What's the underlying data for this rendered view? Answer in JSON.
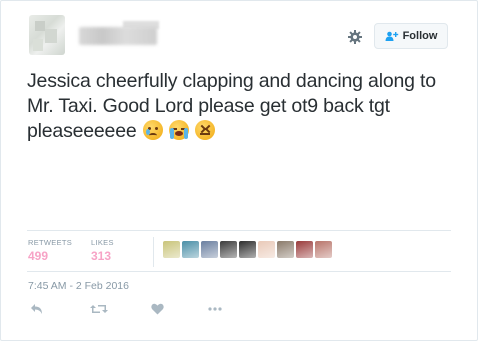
{
  "tweet": {
    "text": "Jessica cheerfully clapping and dancing along to Mr. Taxi. Good Lord please get ot9 back tgt pleaseeeeee",
    "emojis": [
      "crying-face",
      "loudly-crying-face",
      "confounded-face"
    ],
    "follow_label": "Follow",
    "timestamp": "7:45 AM - 2 Feb 2016"
  },
  "stats": {
    "retweets_label": "RETWEETS",
    "retweets_value": "499",
    "likes_label": "LIKES",
    "likes_value": "313"
  },
  "likers": [
    "#c9c47a",
    "#4a8fa7",
    "#6a7fa0",
    "#3b3b3b",
    "#2d2d2d",
    "#e9c9b8",
    "#8a7a6a",
    "#9a3b3b",
    "#b8746a"
  ],
  "colors": {
    "border": "#e1e8ed",
    "muted": "#8899a6",
    "stat_pink": "#f7a3c6",
    "text": "#292f33",
    "button_bg": "#f5f8fa"
  },
  "icons": {
    "gear": "gear-icon",
    "follow": "add-user-icon",
    "reply": "reply-icon",
    "retweet": "retweet-icon",
    "like": "heart-icon",
    "more": "more-icon"
  }
}
